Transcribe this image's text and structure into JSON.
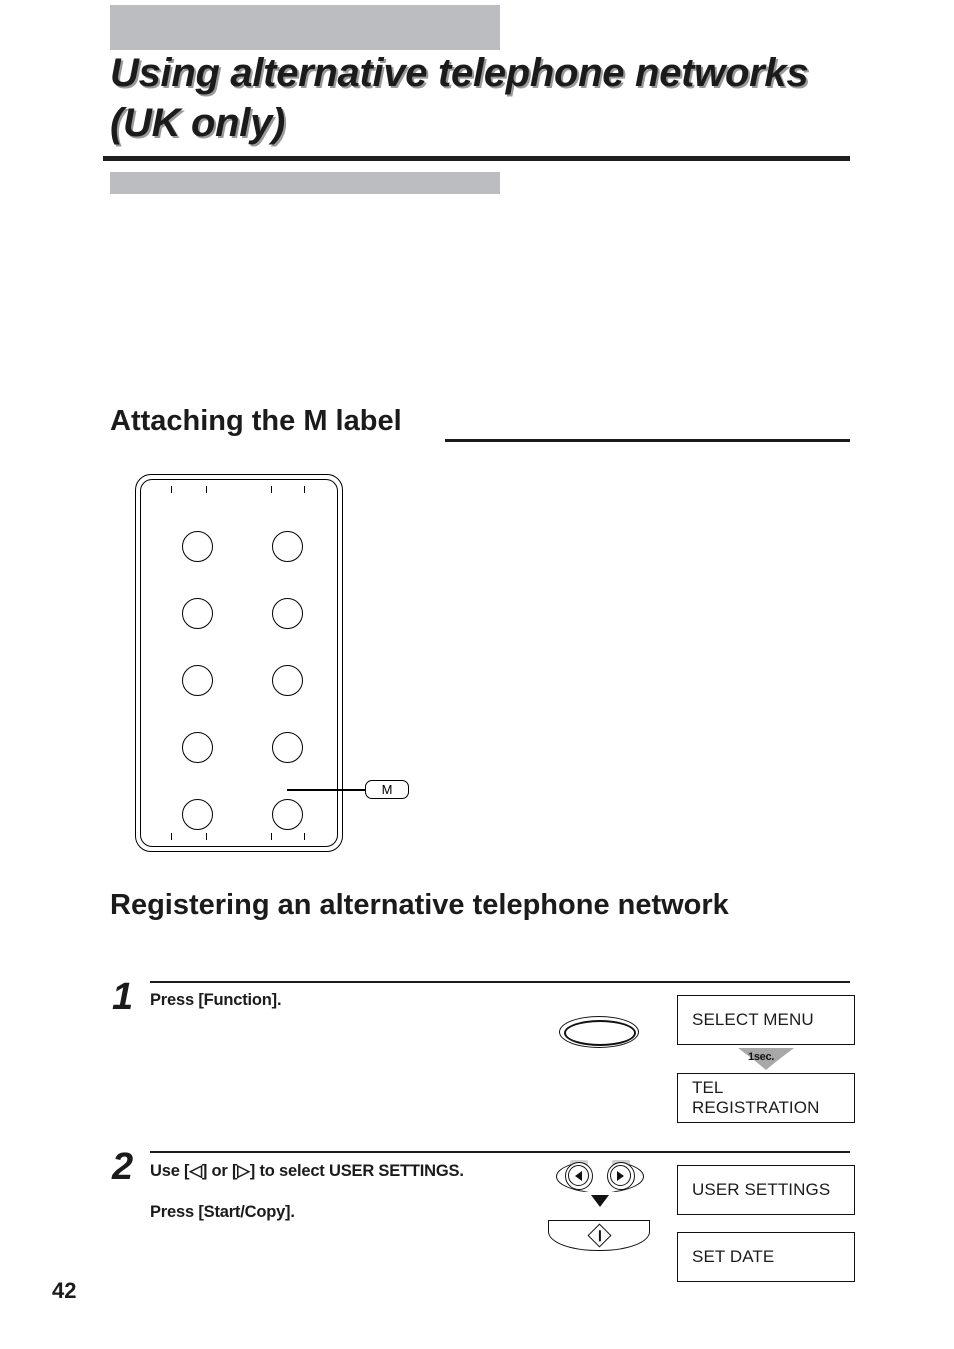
{
  "page": {
    "chapter_title": "Using alternative telephone networks (UK only)",
    "page_number": "42",
    "accent_gray": "#bbbdc0",
    "rule_color": "#1f1f1f"
  },
  "sections": [
    {
      "id": "attaching-m-label",
      "heading": "Attaching the M label",
      "has_trailing_rule": true
    },
    {
      "id": "registering-network",
      "heading": "Registering an alternative telephone network",
      "has_trailing_rule": false
    }
  ],
  "keypad_diagram": {
    "callout_label": "M",
    "rows": 5,
    "columns": 2,
    "button_count": 10
  },
  "steps": [
    {
      "number": "1",
      "lines": [
        "Press [Function]."
      ],
      "control_icons": [
        "function-oval-button"
      ],
      "transition_label": "1sec.",
      "displays": [
        "SELECT MENU",
        "TEL REGISTRATION"
      ]
    },
    {
      "number": "2",
      "lines": [
        "Use [◁] or [▷] to select USER SETTINGS.",
        "Press [Start/Copy]."
      ],
      "control_icons": [
        "arrow-rocker-button",
        "start-copy-button"
      ],
      "displays": [
        "USER SETTINGS",
        "SET DATE"
      ]
    }
  ]
}
